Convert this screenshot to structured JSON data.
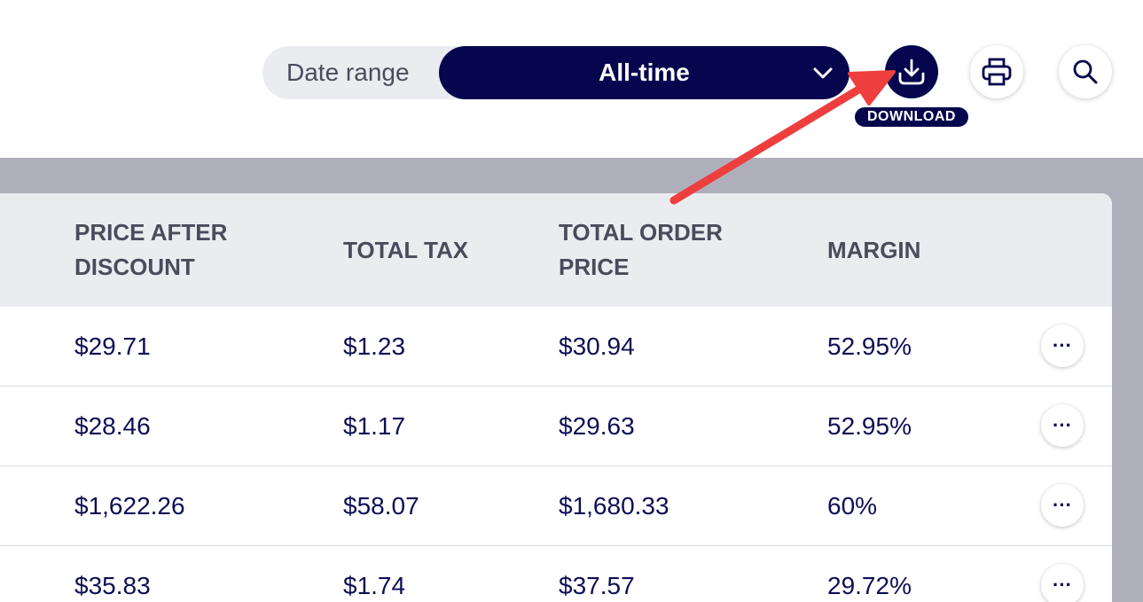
{
  "toolbar": {
    "date_range_label": "Date range",
    "date_range_value": "All-time",
    "download_tooltip": "DOWNLOAD",
    "icons": {
      "dropdown": "chevron-down-icon",
      "download": "download-icon",
      "print": "printer-icon",
      "search": "search-icon"
    }
  },
  "table": {
    "headers": [
      "PRICE AFTER\nDISCOUNT",
      "TOTAL TAX",
      "TOTAL ORDER\nPRICE",
      "MARGIN"
    ],
    "rows": [
      {
        "price_after_discount": "$29.71",
        "total_tax": "$1.23",
        "total_order_price": "$30.94",
        "margin": "52.95%",
        "actions": "···"
      },
      {
        "price_after_discount": "$28.46",
        "total_tax": "$1.17",
        "total_order_price": "$29.63",
        "margin": "52.95%",
        "actions": "···"
      },
      {
        "price_after_discount": "$1,622.26",
        "total_tax": "$58.07",
        "total_order_price": "$1,680.33",
        "margin": "60%",
        "actions": "···"
      },
      {
        "price_after_discount": "$35.83",
        "total_tax": "$1.74",
        "total_order_price": "$37.57",
        "margin": "29.72%",
        "actions": "···"
      }
    ]
  },
  "colors": {
    "navy": "#05064e",
    "header_bg": "#ebecf0",
    "content_bg": "#afafbb",
    "annotation_arrow": "#ef3e3e"
  }
}
